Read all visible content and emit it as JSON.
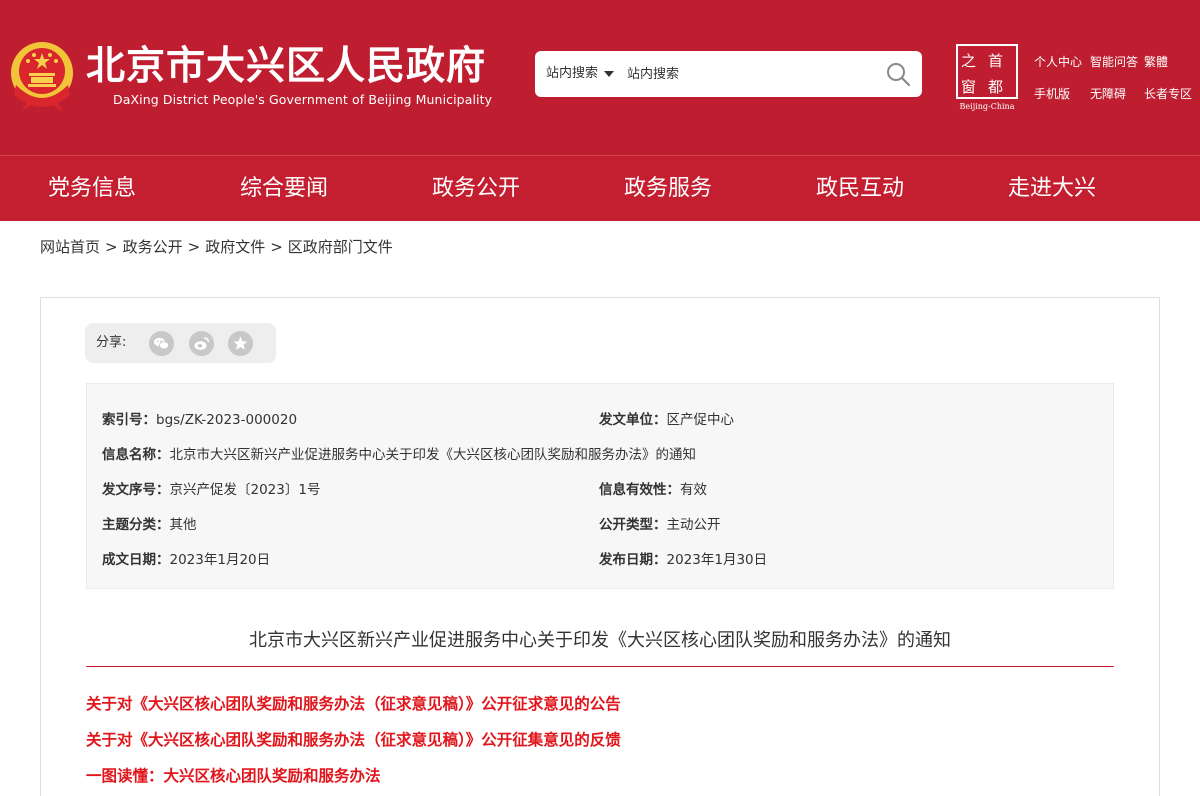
{
  "header": {
    "title": "北京市大兴区人民政府",
    "subtitle": "DaXing District People's Government of Beijing Municipality",
    "search": {
      "scope_label": "站内搜索",
      "placeholder": "站内搜索"
    },
    "capital_logo": {
      "chars": [
        "之",
        "首",
        "窗",
        "都"
      ],
      "caption": "Beijing-China"
    },
    "top_links": [
      "个人中心",
      "智能问答",
      "繁體",
      "手机版",
      "无障碍",
      "长者专区"
    ]
  },
  "nav": [
    "党务信息",
    "综合要闻",
    "政务公开",
    "政务服务",
    "政民互动",
    "走进大兴"
  ],
  "breadcrumb": [
    "网站首页",
    "政务公开",
    "政府文件",
    "区政府部门文件"
  ],
  "breadcrumb_separator": ">",
  "share": {
    "label": "分享:",
    "icons": [
      "wechat-icon",
      "weibo-icon",
      "favorite-star-icon"
    ]
  },
  "meta": {
    "index_no": {
      "label": "索引号：",
      "value": "bgs/ZK-2023-000020"
    },
    "issuer": {
      "label": "发文单位：",
      "value": "区产促中心"
    },
    "info_name": {
      "label": "信息名称：",
      "value": "北京市大兴区新兴产业促进服务中心关于印发《大兴区核心团队奖励和服务办法》的通知"
    },
    "doc_no": {
      "label": "发文序号：",
      "value": "京兴产促发〔2023〕1号"
    },
    "validity": {
      "label": "信息有效性：",
      "value": "有效"
    },
    "category": {
      "label": "主题分类：",
      "value": "其他"
    },
    "disclosure": {
      "label": "公开类型：",
      "value": "主动公开"
    },
    "created_date": {
      "label": "成文日期：",
      "value": "2023年1月20日"
    },
    "published_date": {
      "label": "发布日期：",
      "value": "2023年1月30日"
    }
  },
  "document_title": "北京市大兴区新兴产业促进服务中心关于印发《大兴区核心团队奖励和服务办法》的通知",
  "related_links": [
    "关于对《大兴区核心团队奖励和服务办法（征求意见稿）》公开征求意见的公告",
    "关于对《大兴区核心团队奖励和服务办法（征求意见稿）》公开征集意见的反馈",
    "一图读懂：大兴区核心团队奖励和服务办法"
  ],
  "colors": {
    "brand_red": "#bf1e30",
    "link_red": "#e0161c",
    "meta_bg": "#f7f7f7"
  }
}
